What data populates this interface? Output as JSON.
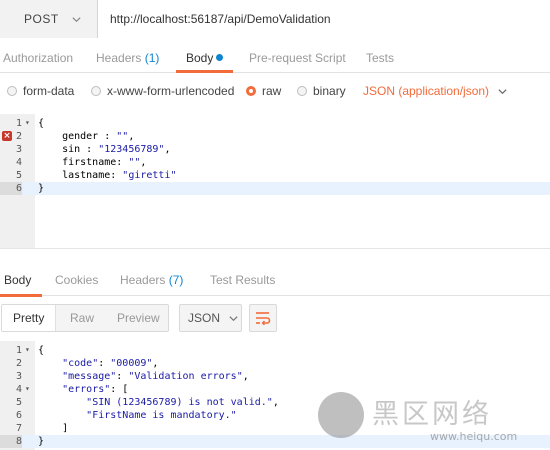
{
  "request": {
    "method": "POST",
    "url": "http://localhost:56187/api/DemoValidation"
  },
  "req_tabs": {
    "authorization": "Authorization",
    "headers": "Headers",
    "headers_count": "(1)",
    "body": "Body",
    "prerequest": "Pre-request Script",
    "tests": "Tests"
  },
  "body_options": {
    "form_data": "form-data",
    "urlencoded": "x-www-form-urlencoded",
    "raw": "raw",
    "binary": "binary",
    "selected": "raw",
    "content_type": "JSON (application/json)"
  },
  "request_body": {
    "lines": [
      {
        "num": "1",
        "text": "{",
        "fold": true
      },
      {
        "num": "2",
        "text": "    gender : \"\",",
        "error": true
      },
      {
        "num": "3",
        "text": "    sin : \"123456789\","
      },
      {
        "num": "4",
        "text": "    firstname: \"\","
      },
      {
        "num": "5",
        "text": "    lastname: \"giretti\""
      },
      {
        "num": "6",
        "text": "}",
        "active": true
      }
    ]
  },
  "resp_tabs": {
    "body": "Body",
    "cookies": "Cookies",
    "headers": "Headers",
    "headers_count": "(7)",
    "test_results": "Test Results"
  },
  "resp_toolbar": {
    "pretty": "Pretty",
    "raw": "Raw",
    "preview": "Preview",
    "format": "JSON"
  },
  "response_body": {
    "lines": [
      {
        "num": "1",
        "text": "{",
        "fold": true
      },
      {
        "num": "2",
        "text": "    \"code\": \"00009\","
      },
      {
        "num": "3",
        "text": "    \"message\": \"Validation errors\","
      },
      {
        "num": "4",
        "text": "    \"errors\": [",
        "fold": true
      },
      {
        "num": "5",
        "text": "        \"SIN (123456789) is not valid.\","
      },
      {
        "num": "6",
        "text": "        \"FirstName is mandatory.\""
      },
      {
        "num": "7",
        "text": "    ]"
      },
      {
        "num": "8",
        "text": "}",
        "active": true
      }
    ]
  },
  "watermark": {
    "text": "黑区网络",
    "url": "www.heiqu.com"
  },
  "colors": {
    "accent": "#f26b3a",
    "link": "#0f85d2",
    "error": "#c8382a",
    "gutter": "#f0f0f0"
  }
}
